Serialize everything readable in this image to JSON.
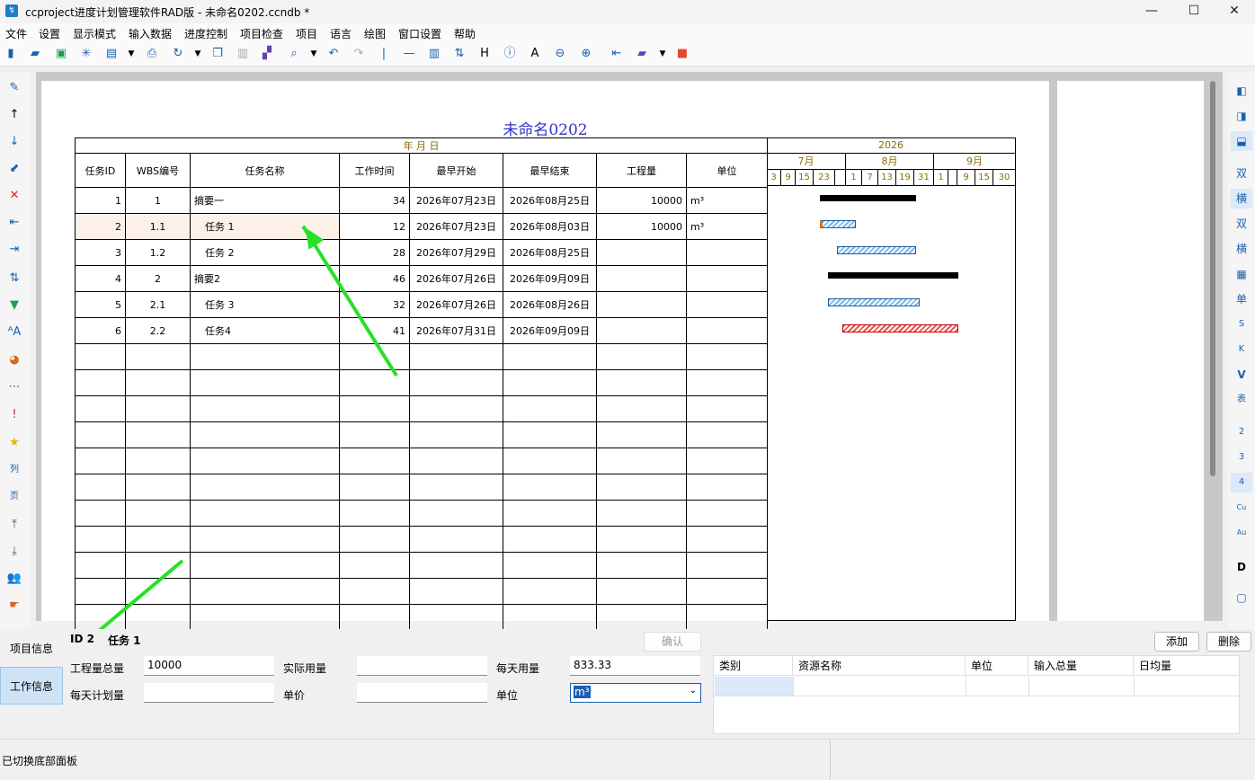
{
  "window": {
    "title": "ccproject进度计划管理软件RAD版 - 未命名0202.ccndb *"
  },
  "menu": [
    "文件",
    "设置",
    "显示模式",
    "输入数据",
    "进度控制",
    "项目检查",
    "项目",
    "语言",
    "绘图",
    "窗口设置",
    "帮助"
  ],
  "document": {
    "title": "未命名0202"
  },
  "table": {
    "date_header": "年 月 日",
    "columns": [
      "任务ID",
      "WBS编号",
      "任务名称",
      "工作时间",
      "最早开始",
      "最早结束",
      "工程量",
      "单位"
    ],
    "rows": [
      {
        "id": "1",
        "wbs": "1",
        "name": "摘要一",
        "duration": "34",
        "start": "2026年07月23日",
        "finish": "2026年08月25日",
        "qty": "10000",
        "unit": "m³"
      },
      {
        "id": "2",
        "wbs": "1.1",
        "name": "任务 1",
        "duration": "12",
        "start": "2026年07月23日",
        "finish": "2026年08月03日",
        "qty": "10000",
        "unit": "m³"
      },
      {
        "id": "3",
        "wbs": "1.2",
        "name": "任务 2",
        "duration": "28",
        "start": "2026年07月29日",
        "finish": "2026年08月25日",
        "qty": "",
        "unit": ""
      },
      {
        "id": "4",
        "wbs": "2",
        "name": "摘要2",
        "duration": "46",
        "start": "2026年07月26日",
        "finish": "2026年09月09日",
        "qty": "",
        "unit": ""
      },
      {
        "id": "5",
        "wbs": "2.1",
        "name": "任务 3",
        "duration": "32",
        "start": "2026年07月26日",
        "finish": "2026年08月26日",
        "qty": "",
        "unit": ""
      },
      {
        "id": "6",
        "wbs": "2.2",
        "name": "任务4",
        "duration": "41",
        "start": "2026年07月31日",
        "finish": "2026年09月09日",
        "qty": "",
        "unit": ""
      }
    ]
  },
  "gantt": {
    "year": "2026",
    "months": [
      "7月",
      "8月",
      "9月"
    ],
    "days": [
      "3",
      "9",
      "15",
      "23",
      "",
      "1",
      "7",
      "13",
      "19",
      "31",
      "1",
      "",
      "9",
      "15",
      "30"
    ]
  },
  "bottom": {
    "tabs": {
      "project": "项目信息",
      "work": "工作信息"
    },
    "task_id_label": "ID 2",
    "task_name": "任务 1",
    "confirm": "确认",
    "add": "添加",
    "delete": "删除",
    "labels": {
      "total_qty": "工程量总量",
      "actual_qty": "实际用量",
      "daily_qty": "每天用量",
      "daily_plan": "每天计划量",
      "unit_price": "单价",
      "unit": "单位"
    },
    "values": {
      "total_qty": "10000",
      "actual_qty": "",
      "daily_qty": "833.33",
      "daily_plan": "",
      "unit_price": "",
      "unit": "m³"
    },
    "resource_columns": [
      "类别",
      "资源名称",
      "单位",
      "输入总量",
      "日均量"
    ]
  },
  "status": "已切换底部面板",
  "colors": {
    "accent": "#27e027",
    "title": "#3333cc",
    "selected_row": "#fdf0e8"
  }
}
